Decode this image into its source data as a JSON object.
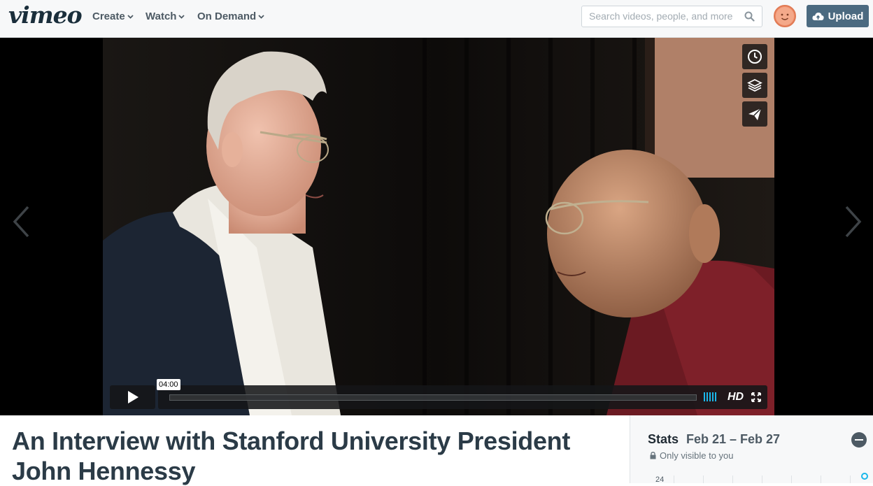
{
  "header": {
    "logo": "vimeo",
    "nav": [
      {
        "label": "Create"
      },
      {
        "label": "Watch"
      },
      {
        "label": "On Demand"
      }
    ],
    "search_placeholder": "Search videos, people, and more",
    "upload_label": "Upload"
  },
  "player": {
    "timecode": "04:00",
    "quality": "HD",
    "progress_fraction": 0.0
  },
  "video": {
    "title": "An Interview with Stanford University President John Hennessy"
  },
  "stats": {
    "label": "Stats",
    "range": "Feb 21 – Feb 27",
    "visibility": "Only visible to you",
    "first_tick": "24"
  },
  "colors": {
    "accent": "#1ab7ea",
    "upload_bg": "#4b6a80",
    "title": "#2b3b47"
  }
}
